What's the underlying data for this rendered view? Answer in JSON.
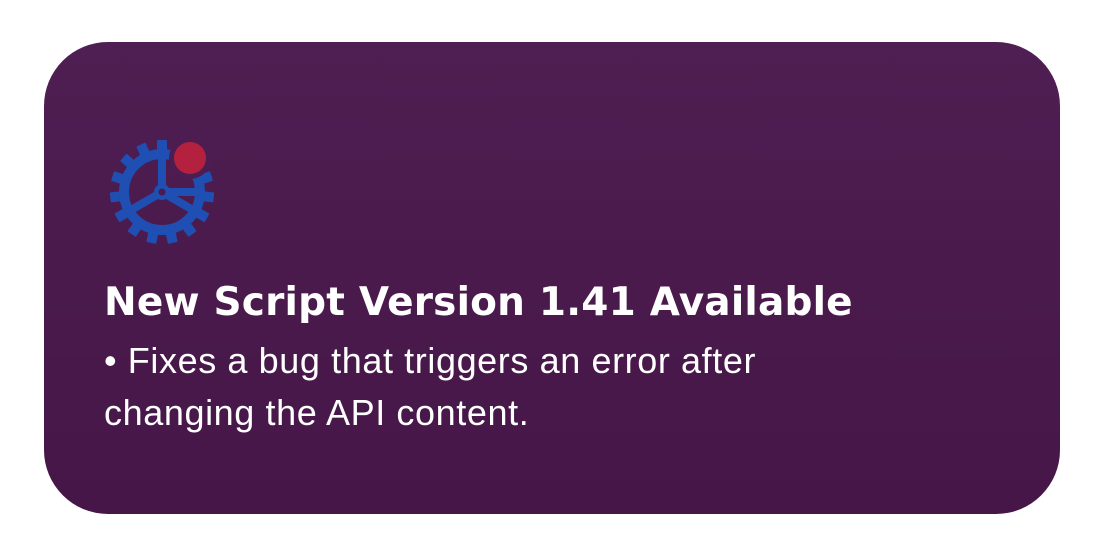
{
  "notification": {
    "icon": "gear-update-icon",
    "title": "New Script Version 1.41 Available",
    "message": "• Fixes a bug that triggers an error after changing the API content."
  },
  "colors": {
    "card_background": "#4b1b4f",
    "icon_gear": "#1f4fb3",
    "badge_dot": "#b3213f",
    "text": "#ffffff"
  }
}
